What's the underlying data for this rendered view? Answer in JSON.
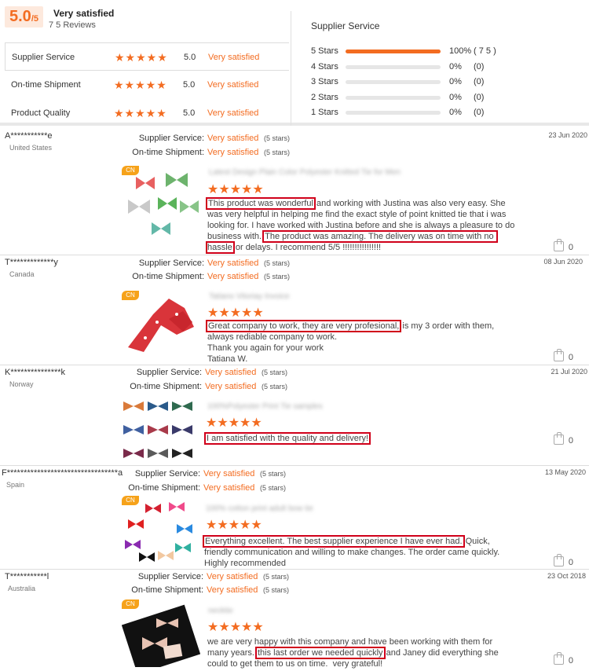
{
  "summary": {
    "score": "5.0",
    "score_suffix": "/5",
    "headline": "Very satisfied",
    "reviews_count": "7 5 Reviews",
    "metrics": [
      {
        "label": "Supplier Service",
        "score": "5.0",
        "text": "Very satisfied",
        "stars": "★★★★★"
      },
      {
        "label": "On-time Shipment",
        "score": "5.0",
        "text": "Very satisfied",
        "stars": "★★★★★"
      },
      {
        "label": "Product Quality",
        "score": "5.0",
        "text": "Very satisfied",
        "stars": "★★★★★"
      }
    ],
    "distribution_title": "Supplier Service",
    "distribution": [
      {
        "label": "5 Stars",
        "pct": "100%",
        "count": "( 7 5 )",
        "fraction": 1.0
      },
      {
        "label": "4 Stars",
        "pct": "0%",
        "count": "(0)",
        "fraction": 0
      },
      {
        "label": "3 Stars",
        "pct": "0%",
        "count": "(0)",
        "fraction": 0
      },
      {
        "label": "2 Stars",
        "pct": "0%",
        "count": "(0)",
        "fraction": 0
      },
      {
        "label": "1 Stars",
        "pct": "0%",
        "count": "(0)",
        "fraction": 0
      }
    ]
  },
  "labels": {
    "supplier_service": "Supplier Service:",
    "ontime_shipment": "On-time Shipment:",
    "very_satisfied": "Very satisfied",
    "five_stars": "(5 stars)",
    "cn": "CN"
  },
  "reviews": [
    {
      "user": "A***********e",
      "country": "United States",
      "date": "23 Jun 2020",
      "product": "Latest Design Plain Color Polyester Knitted Tie for Men",
      "stars": "★★★★★",
      "text_before": "",
      "hl1": "This product was wonderful",
      "text_mid": " and working with Justina was also very easy. She was very helpful in helping me find the exact style of point knitted tie that i was looking for. I have worked with Justina before and she is always a pleasure to do business with. ",
      "hl2": "The product was amazing. The delivery was on time with no hassle",
      "text_after": " or delays. I recommend 5/5 !!!!!!!!!!!!!!!!",
      "likes": "0"
    },
    {
      "user": "T*************y",
      "country": "Canada",
      "date": "08 Jun 2020",
      "product": "Tatiano Vitoriay Invoice",
      "stars": "★★★★★",
      "text_before": "",
      "hl1": "Great company to work, they are very profesional,",
      "text_mid": " is my 3 order with them, always rediable company to work.\nThank you again for your work\nTatiana W.",
      "hl2": "",
      "text_after": "",
      "likes": "0"
    },
    {
      "user": "K***************k",
      "country": "Norway",
      "date": "21 Jul 2020",
      "product": "100%Polyester Print Tie samples",
      "stars": "★★★★★",
      "text_before": "",
      "hl1": "I am satisfied with the quality and delivery!",
      "text_mid": "",
      "hl2": "",
      "text_after": "",
      "likes": "0"
    },
    {
      "user": "F*********************************a",
      "country": "Spain",
      "date": "13 May 2020",
      "product": "100% cotton print adult bow tie",
      "stars": "★★★★★",
      "text_before": "",
      "hl1": "Everything excellent. The best supplier experience I have ever had.",
      "text_mid": " Quick, friendly communication and willing to make changes. The order came quickly. Highly recommended",
      "hl2": "",
      "text_after": "",
      "likes": "0"
    },
    {
      "user": "T***********l",
      "country": "Australia",
      "date": "23 Oct 2018",
      "product": "necktie",
      "stars": "★★★★★",
      "text_before": "we are very happy with this company and have been working with them for many years. ",
      "hl1": "this last order we needed quickly",
      "text_mid": " and Janey did everything she could to get them to us on time.  very grateful!",
      "hl2": "",
      "text_after": "",
      "likes": "0"
    }
  ]
}
